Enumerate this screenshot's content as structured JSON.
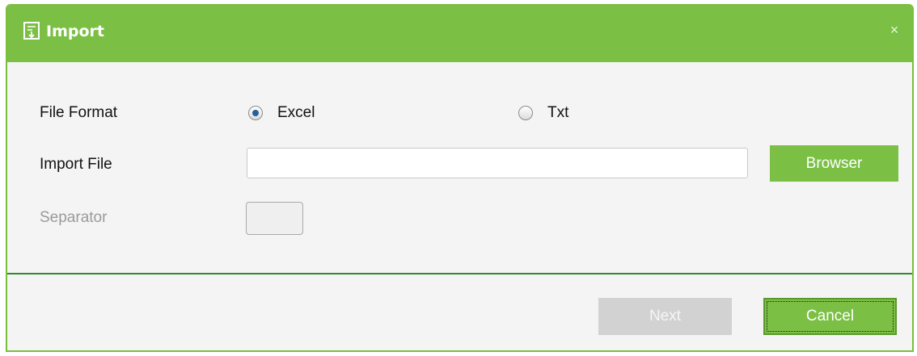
{
  "dialog": {
    "title": "Import",
    "title_icon": "import-icon",
    "close_glyph": "×",
    "close_icon": "close-icon",
    "accent_color": "#7bbf44"
  },
  "form": {
    "file_format": {
      "label": "File Format",
      "options": [
        {
          "label": "Excel",
          "checked": true
        },
        {
          "label": "Txt",
          "checked": false
        }
      ]
    },
    "import_file": {
      "label": "Import File",
      "value": "",
      "browse_label": "Browser"
    },
    "separator": {
      "label": "Separator",
      "value": "",
      "disabled": true
    }
  },
  "footer": {
    "next_label": "Next",
    "next_disabled": true,
    "cancel_label": "Cancel"
  }
}
